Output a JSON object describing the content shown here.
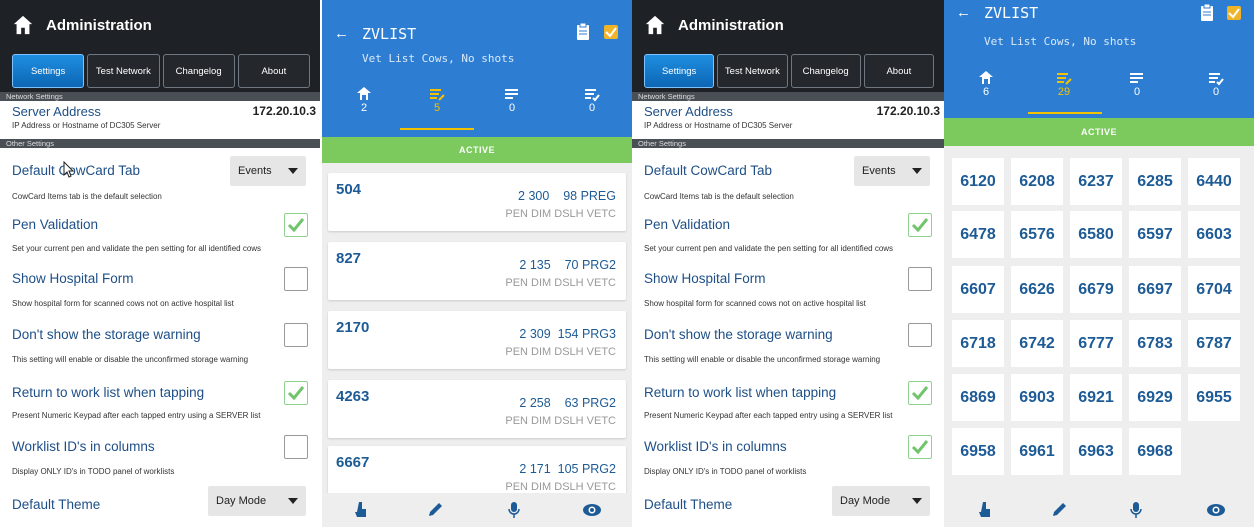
{
  "settings": {
    "title": "Administration",
    "tabs": [
      "Settings",
      "Test Network",
      "Changelog",
      "About"
    ],
    "network_section": "Network Settings",
    "server_label": "Server Address",
    "server_value": "172.20.10.3",
    "server_desc": "IP Address or Hostname of DC305 Server",
    "other_section": "Other Settings",
    "cowcard_label": "Default CowCard Tab",
    "cowcard_value": "Events",
    "cowcard_desc": "CowCard Items tab is the default selection",
    "pen_label": "Pen Validation",
    "pen_desc": "Set your current pen and validate the pen setting for all identified cows",
    "hospital_label": "Show Hospital Form",
    "hospital_desc": "Show hospital form for scanned cows not on active hospital list",
    "storage_label": "Don't show the storage warning",
    "storage_desc": "This setting will enable or disable the unconfirmed storage warning",
    "return_label": "Return to work list when tapping",
    "return_desc": "Present Numeric Keypad after each tapped entry using a SERVER list",
    "columns_label": "Worklist ID's in columns",
    "columns_desc": "Display ONLY ID's in TODO panel of worklists",
    "theme_label": "Default Theme",
    "theme_value": "Day Mode"
  },
  "list": {
    "title": "ZVLIST",
    "subtitle": "Vet List Cows, No shots",
    "counts_a": [
      "2",
      "5",
      "0",
      "0"
    ],
    "counts_b": [
      "6",
      "29",
      "0",
      "0"
    ],
    "status": "ACTIVE",
    "col_header": "PEN DIM DSLH VETC",
    "cards": [
      {
        "id": "504",
        "vals": "2 300    98 PREG"
      },
      {
        "id": "827",
        "vals": "2 135    70 PRG2"
      },
      {
        "id": "2170",
        "vals": "2 309  154 PRG3"
      },
      {
        "id": "4263",
        "vals": "2 258    63 PRG2"
      },
      {
        "id": "6667",
        "vals": "2 171  105 PRG2"
      }
    ],
    "grid": [
      "6120",
      "6208",
      "6237",
      "6285",
      "6440",
      "6478",
      "6576",
      "6580",
      "6597",
      "6603",
      "6607",
      "6626",
      "6679",
      "6697",
      "6704",
      "6718",
      "6742",
      "6777",
      "6783",
      "6787",
      "6869",
      "6903",
      "6921",
      "6929",
      "6955",
      "6958",
      "6961",
      "6963",
      "6968"
    ]
  },
  "icons": [
    "home-icon",
    "back-arrow-icon",
    "clipboard-icon",
    "checkbox-icon",
    "cow-icon",
    "todo-icon",
    "list-icon",
    "done-icon",
    "hand-icon",
    "edit-icon",
    "mic-icon",
    "eye-icon"
  ],
  "colors": {
    "header_blue": "#2d7ed3",
    "active_green": "#7cc95e",
    "tab_blue": "#1f8ee0",
    "accent_yellow": "#f2c200",
    "id_blue": "#1d5b96"
  }
}
